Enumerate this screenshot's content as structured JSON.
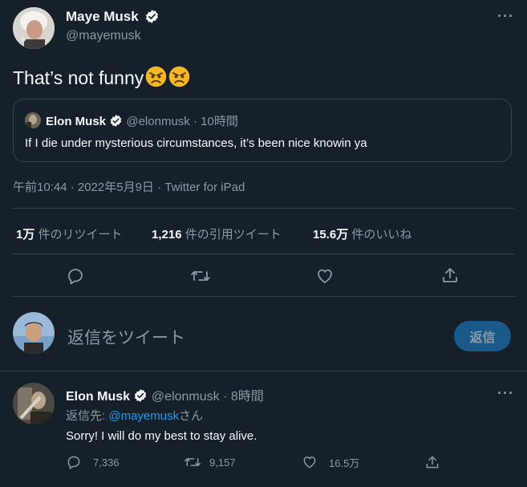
{
  "tweet": {
    "author_name": "Maye Musk",
    "author_handle": "@mayemusk",
    "text": "That’s not funny",
    "emoji": [
      "angry-face",
      "angry-face"
    ],
    "quoted": {
      "author_name": "Elon Musk",
      "author_handle": "@elonmusk",
      "time": "· 10時間",
      "text": "If I die under mysterious circumstances, it’s been nice knowin ya"
    },
    "meta": "午前10:44 · 2022年5月9日 · Twitter for iPad",
    "stats": {
      "retweets_num": "1万",
      "retweets_label": "件のリツイート",
      "quotes_num": "1,216",
      "quotes_label": "件の引用ツイート",
      "likes_num": "15.6万",
      "likes_label": "件のいいね"
    }
  },
  "compose": {
    "placeholder": "返信をツイート",
    "reply_button": "返信"
  },
  "reply": {
    "author_name": "Elon Musk",
    "author_handle": "@elonmusk",
    "time": "· 8時間",
    "replying_prefix": "返信先: ",
    "replying_handle": "@mayemusk",
    "replying_suffix": "さん",
    "text": "Sorry! I will do my best to stay alive.",
    "replies": "7,336",
    "retweets": "9,157",
    "likes": "16.5万"
  },
  "colors": {
    "background": "#15202b",
    "accent": "#1d9bf0",
    "muted": "#8b98a5",
    "divider": "#38444d"
  }
}
